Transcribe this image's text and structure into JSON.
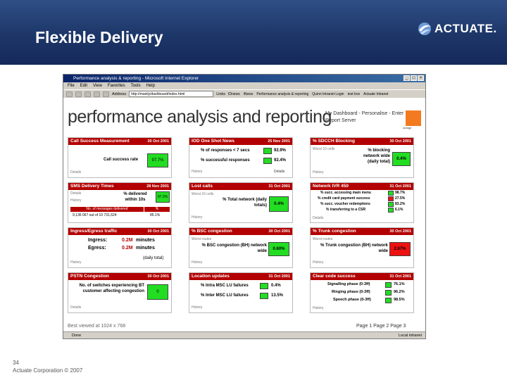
{
  "slide": {
    "title": "Flexible Delivery",
    "logo_text": "ACTUATE.",
    "page_number": "34",
    "copyright": "Actuate Corporation © 2007"
  },
  "browser": {
    "window_title": "Performance analysis & reporting - Microsoft Internet Explorer",
    "menu": [
      "File",
      "Edit",
      "View",
      "Favorites",
      "Tools",
      "Help"
    ],
    "address_label": "Address",
    "address": "http://mainly/dashboard/index.html",
    "links_label": "Links",
    "links": [
      "IDnews",
      "iNews",
      "Performance analysis & reporting",
      "Quinn Intranet Login",
      "test box",
      "Actuate Intranet"
    ],
    "status": "Done",
    "zone": "Local intranet"
  },
  "page": {
    "big_title": "performance analysis and reporting",
    "dash_links": "My Dashboard - Personalise - Enter Report Server",
    "orange_label": "orange",
    "best_viewed": "Best viewed at 1024 x 768",
    "pages": "Page 1   Page 2   Page 3"
  },
  "panels": {
    "call_success": {
      "title": "Call Success Measurement",
      "date": "30 Oct 2001",
      "label": "Call success rate",
      "value": "97.7%",
      "link": "Details"
    },
    "iod": {
      "title": "IOD One Shot News",
      "date": "25 Nov 2001",
      "row1_label": "% of responses < 7 secs",
      "row1_value": "92.9%",
      "row2_label": "% successful responses",
      "row2_value": "92.4%",
      "history": "History",
      "details": "Details"
    },
    "sdcch": {
      "title": "% SDCCH Blocking",
      "date": "30 Oct 2001",
      "worst": "Worst 10 cells",
      "label": "% blocking network wide (daily total)",
      "value": "0.4%",
      "history": "History"
    },
    "sms": {
      "title": "SMS Delivery Times",
      "date": "28 Nov 2001",
      "details": "Details",
      "history": "History",
      "label": "% delivered within 10s",
      "value": "97.2%",
      "col1": "No. of messages delivered",
      "col2": "%",
      "row_left": "9,136 067 out of 10 731,624",
      "row_right": "85.1%"
    },
    "lost_calls": {
      "title": "Lost calls",
      "date": "31 Oct 2001",
      "worst": "Worst 10 cells",
      "label": "% Total network (daily totals)",
      "value": "0.4%",
      "history": "History"
    },
    "ivr": {
      "title": "Network IVR 450",
      "date": "31 Oct 2001",
      "rows": [
        {
          "label": "% succ. accessing main menu",
          "value": "98.7%"
        },
        {
          "label": "% credit card payment success",
          "value": "27.5%"
        },
        {
          "label": "% succ. voucher redemptions",
          "value": "83.2%"
        },
        {
          "label": "% transferring to a CSR",
          "value": "6.1%"
        }
      ],
      "history": "Details"
    },
    "ingress": {
      "title": "Ingress/Egress traffic",
      "date": "30 Oct 2001",
      "ingress_label": "Ingress:",
      "ingress_value": "0.2M",
      "egress_label": "Egress:",
      "egress_value": "0.2M",
      "unit": "minutes",
      "daily": "(daily total)",
      "history": "History"
    },
    "bsc": {
      "title": "% BSC congestion",
      "date": "30 Oct 2001",
      "worst": "Worst routes",
      "label": "% BSC congestion (BH) network wide",
      "value": "0.60%",
      "history": "History"
    },
    "trunk": {
      "title": "% Trunk congestion",
      "date": "30 Oct 2001",
      "worst": "Worst routes",
      "label": "% Trunk congestion (BH) network wide",
      "value": "2.67%",
      "history": "History"
    },
    "pstn": {
      "title": "PSTN Congestion",
      "date": "30 Oct 2001",
      "label": "No. of switches experiencing BT customer affecting congestion",
      "value": "0",
      "details": "Details"
    },
    "location": {
      "title": "Location updates",
      "date": "31 Oct 2001",
      "row1_label": "% Intra MSC LU failures",
      "row1_value": "0.4%",
      "row2_label": "% Inter MSC LU failures",
      "row2_value": "13.5%",
      "history": "History"
    },
    "clear_code": {
      "title": "Clear code success",
      "date": "31 Oct 2001",
      "rows": [
        {
          "label": "Signalling phase (0-3ff)",
          "value": "76.1%"
        },
        {
          "label": "Ringing phase (0-3ff)",
          "value": "96.2%"
        },
        {
          "label": "Speech phase (0-3ff)",
          "value": "98.5%"
        }
      ],
      "history": "History"
    }
  }
}
